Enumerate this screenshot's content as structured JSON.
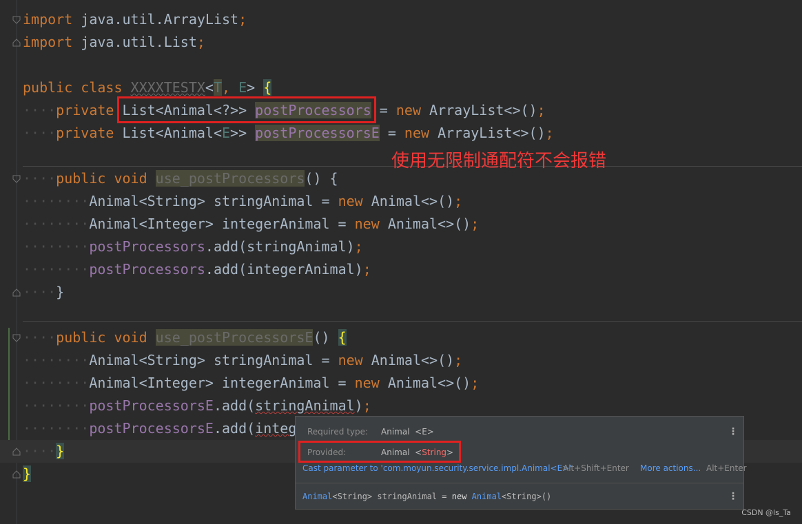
{
  "editor": {
    "lines": {
      "l1": {
        "kw": "import",
        "rest": " java.util.ArrayList",
        "semi": ";"
      },
      "l2": {
        "kw": "import",
        "rest": " java.util.List",
        "semi": ";"
      },
      "l4": {
        "kw": "public class ",
        "name": "XXXXTESTX",
        "lt": "<",
        "t": "T",
        "comma": ", ",
        "e": "E",
        "gt": "> ",
        "brace": "{"
      },
      "l5": {
        "indent": "····",
        "kw": "private ",
        "type": "List<Animal<?>> ",
        "field": "postProcessors",
        "rest1": " = ",
        "kw2": "new ",
        "rest2": "ArrayList<>()",
        "semi": ";"
      },
      "l6": {
        "indent": "····",
        "kw": "private ",
        "type_a": "List<Animal<",
        "e": "E",
        "type_b": ">> ",
        "field": "postProcessorsE",
        "rest1": " = ",
        "kw2": "new ",
        "rest2": "ArrayList<>()",
        "semi": ";"
      },
      "l8": {
        "indent": "····",
        "kw": "public void ",
        "name": "use_postProcessors",
        "rest": "() {"
      },
      "l9": {
        "indent": "········",
        "type": "Animal<String> stringAnimal = ",
        "kw": "new ",
        "rest": "Animal<>()",
        "semi": ";"
      },
      "l10": {
        "indent": "········",
        "type": "Animal<Integer> integerAnimal = ",
        "kw": "new ",
        "rest": "Animal<>()",
        "semi": ";"
      },
      "l11": {
        "indent": "········",
        "field": "postProcessors",
        "rest": ".add(stringAnimal)",
        "semi": ";"
      },
      "l12": {
        "indent": "········",
        "field": "postProcessors",
        "rest": ".add(integerAnimal)",
        "semi": ";"
      },
      "l13": {
        "indent": "····",
        "rest": "}"
      },
      "l15": {
        "indent": "····",
        "kw": "public void ",
        "name": "use_postProcessorsE",
        "rest": "() ",
        "brace": "{"
      },
      "l16": {
        "indent": "········",
        "type": "Animal<String> stringAnimal = ",
        "kw": "new ",
        "rest": "Animal<>()",
        "semi": ";"
      },
      "l17": {
        "indent": "········",
        "type": "Animal<Integer> integerAnimal = ",
        "kw": "new ",
        "rest": "Animal<>()",
        "semi": ";"
      },
      "l18": {
        "indent": "········",
        "field": "postProcessorsE",
        "rest_a": ".add(",
        "err": "stringAnimal",
        "rest_b": ")",
        "semi": ";"
      },
      "l19": {
        "indent": "········",
        "field": "postProcessorsE",
        "rest_a": ".add(",
        "err": "integ"
      },
      "l20": {
        "indent": "····",
        "brace": "}"
      },
      "l21": {
        "brace": "}"
      }
    },
    "annotation": "使用无限制通配符不会报错"
  },
  "popup": {
    "required_label": "Required type:",
    "required_value": "Animal",
    "required_param": "<E>",
    "provided_label": "Provided:",
    "provided_value": "Animal",
    "provided_lt": "<",
    "provided_param": "String",
    "provided_gt": ">",
    "cast_action": "Cast parameter to 'com.moyun.security.service.impl.Animal<E>'",
    "cast_shortcut": "Alt+Shift+Enter",
    "more_actions": "More actions...",
    "more_shortcut": "Alt+Enter",
    "snippet": {
      "cls1": "Animal",
      "p1": "<String> ",
      "var": "stringAnimal = ",
      "kw": "new ",
      "cls2": "Animal",
      "p2": "<String>",
      "tail": "()"
    },
    "kebab_icon": "⋮"
  },
  "watermark": "CSDN @ls_Ta"
}
